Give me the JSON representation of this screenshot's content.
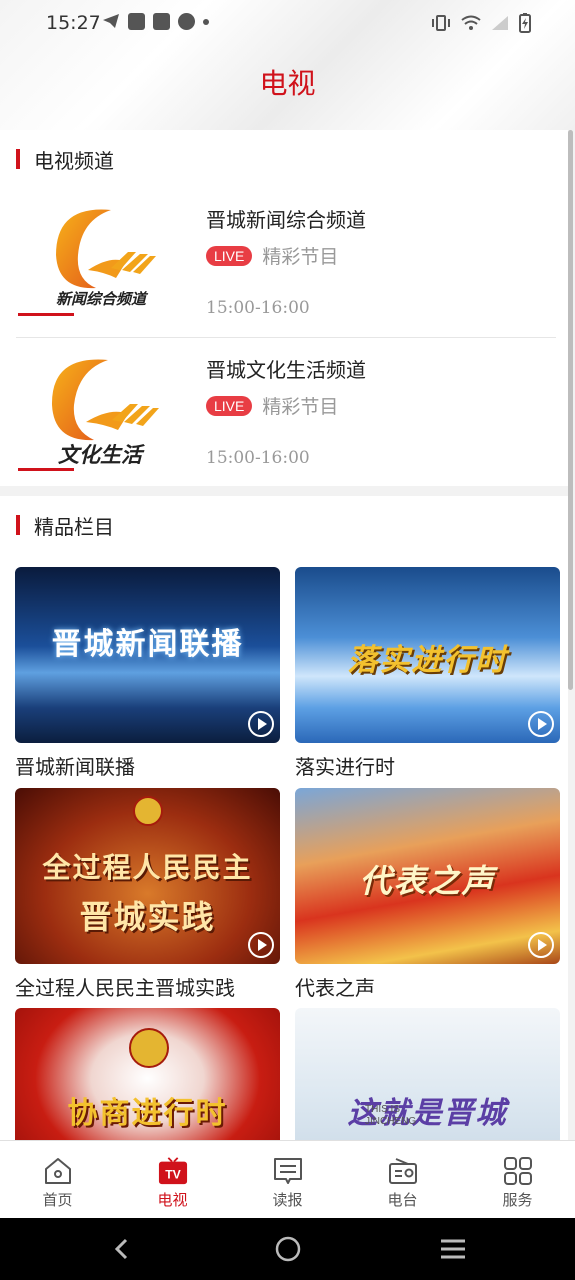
{
  "status_bar": {
    "time": "15:27"
  },
  "header": {
    "title": "电视"
  },
  "tv_section": {
    "heading": "电视频道",
    "channels": [
      {
        "name": "晋城新闻综合频道",
        "live_badge": "LIVE",
        "program": "精彩节目",
        "time": "15:00-16:00",
        "logo_text": "新闻综合频道"
      },
      {
        "name": "晋城文化生活频道",
        "live_badge": "LIVE",
        "program": "精彩节目",
        "time": "15:00-16:00",
        "logo_text": "文化生活"
      }
    ]
  },
  "programs_section": {
    "heading": "精品栏目",
    "items": [
      {
        "label": "晋城新闻联播",
        "thumb_text": "晋城新闻联播"
      },
      {
        "label": "落实进行时",
        "thumb_text": "落实进行时"
      },
      {
        "label": "全过程人民民主晋城实践",
        "thumb_text_1": "全过程人民民主",
        "thumb_text_2": "晋城实践"
      },
      {
        "label": "代表之声",
        "thumb_text": "代表之声"
      },
      {
        "label": "",
        "thumb_text": "协商进行时"
      },
      {
        "label": "",
        "thumb_text": "这就是晋城",
        "thumb_sub_1": "THIS IS",
        "thumb_sub_2": "JINCHENG"
      }
    ]
  },
  "tabbar": {
    "tabs": [
      {
        "label": "首页",
        "icon": "home-icon"
      },
      {
        "label": "电视",
        "icon": "tv-icon",
        "badge": "TV",
        "active": true
      },
      {
        "label": "读报",
        "icon": "newspaper-icon"
      },
      {
        "label": "电台",
        "icon": "radio-icon"
      },
      {
        "label": "服务",
        "icon": "grid-icon"
      }
    ]
  },
  "colors": {
    "accent": "#d0121b",
    "live": "#e83d44"
  }
}
